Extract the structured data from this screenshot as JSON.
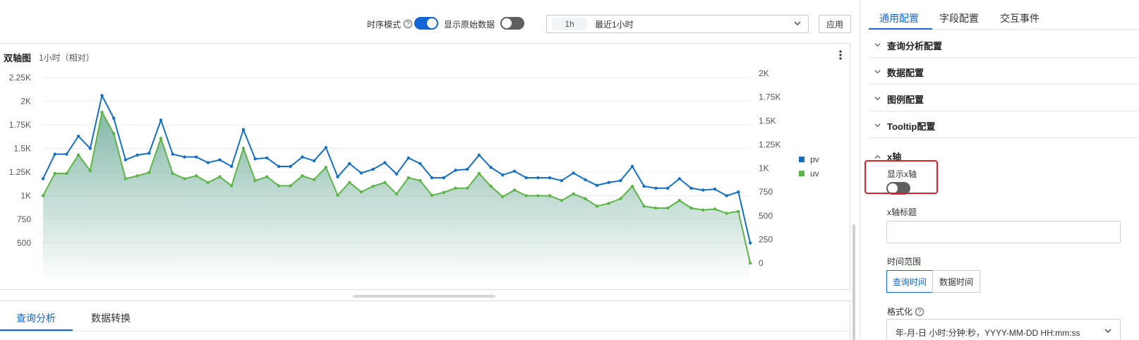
{
  "toolbar": {
    "timeseries_mode_label": "时序模式",
    "timeseries_mode_on": true,
    "show_raw_label": "显示原始数据",
    "show_raw_on": false,
    "time_tag": "1h",
    "time_range_label": "最近1小时",
    "apply_label": "应用"
  },
  "chart_panel": {
    "title": "双轴图",
    "subtitle": "1小时（相对）"
  },
  "bottom_tabs": [
    {
      "label": "查询分析",
      "active": true
    },
    {
      "label": "数据转换",
      "active": false
    }
  ],
  "config": {
    "tabs": [
      {
        "label": "通用配置",
        "active": true
      },
      {
        "label": "字段配置",
        "active": false
      },
      {
        "label": "交互事件",
        "active": false
      }
    ],
    "sections": [
      {
        "label": "查询分析配置"
      },
      {
        "label": "数据配置"
      },
      {
        "label": "图例配置"
      },
      {
        "label": "Tooltip配置"
      }
    ],
    "xaxis": {
      "title": "x轴",
      "show_label": "显示x轴",
      "show_on": false,
      "title_field_label": "x轴标题",
      "title_field_value": "",
      "time_range_label": "时间范围",
      "time_range_options": [
        {
          "label": "查询时间",
          "active": true
        },
        {
          "label": "数据时间",
          "active": false
        }
      ],
      "format_label": "格式化",
      "format_value": "年-月-日 小时:分钟:秒，YYYY-MM-DD HH:mm:ss"
    }
  },
  "colors": {
    "accent": "#1466d4",
    "pv": "#1570c5",
    "uv": "#5cb546",
    "area_top": "#6fac99",
    "highlight": "#e0202a"
  },
  "chart_data": {
    "type": "line",
    "title": "",
    "left_axis": {
      "ticks": [
        "500",
        "750",
        "1K",
        "1.25K",
        "1.5K",
        "1.75K",
        "2K",
        "2.25K"
      ],
      "ylim": [
        250,
        2250
      ]
    },
    "right_axis": {
      "ticks": [
        "0",
        "250",
        "500",
        "750",
        "1K",
        "1.25K",
        "1.5K",
        "1.75K",
        "2K"
      ],
      "ylim": [
        0,
        2000
      ]
    },
    "grid": true,
    "legend": {
      "placement": "right",
      "entries": [
        "pv",
        "uv"
      ]
    },
    "series": [
      {
        "name": "pv",
        "axis": "left",
        "values": [
          1180,
          1440,
          1440,
          1630,
          1500,
          2060,
          1820,
          1380,
          1430,
          1450,
          1800,
          1440,
          1410,
          1410,
          1350,
          1380,
          1310,
          1700,
          1390,
          1400,
          1310,
          1310,
          1410,
          1370,
          1510,
          1200,
          1340,
          1240,
          1280,
          1350,
          1230,
          1400,
          1340,
          1190,
          1190,
          1270,
          1280,
          1430,
          1300,
          1220,
          1260,
          1190,
          1190,
          1190,
          1160,
          1240,
          1170,
          1110,
          1140,
          1160,
          1310,
          1100,
          1080,
          1080,
          1180,
          1080,
          1060,
          1070,
          1000,
          1040,
          500
        ]
      },
      {
        "name": "uv",
        "axis": "right",
        "values": [
          710,
          945,
          945,
          1140,
          975,
          1590,
          1365,
          890,
          920,
          955,
          1315,
          945,
          890,
          920,
          850,
          910,
          815,
          1210,
          870,
          910,
          815,
          815,
          920,
          880,
          1010,
          715,
          850,
          750,
          810,
          850,
          730,
          900,
          870,
          715,
          745,
          790,
          790,
          945,
          810,
          700,
          770,
          710,
          710,
          710,
          660,
          730,
          680,
          600,
          630,
          680,
          810,
          600,
          580,
          580,
          660,
          580,
          560,
          570,
          525,
          545,
          0
        ]
      }
    ]
  }
}
